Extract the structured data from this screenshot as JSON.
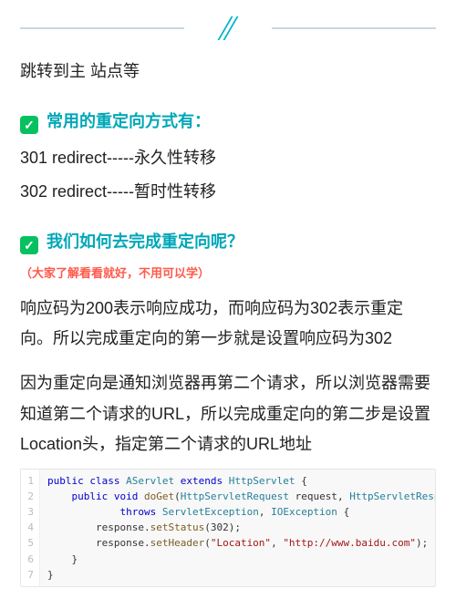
{
  "intro": "跳转到主 站点等",
  "section1": {
    "heading": "常用的重定向方式有：",
    "lines": [
      "301 redirect-----永久性转移",
      "302 redirect-----暂时性转移"
    ]
  },
  "section2": {
    "heading": "我们如何去完成重定向呢？",
    "note": "（大家了解看看就好，不用可以学）",
    "para1": "响应码为200表示响应成功，而响应码为302表示重定向。所以完成重定向的第一步就是设置响应码为302",
    "para2": "因为重定向是通知浏览器再第二个请求，所以浏览器需要知道第二个请求的URL，所以完成重定向的第二步是设置Location头，指定第二个请求的URL地址"
  },
  "code": {
    "l1": "public class AServlet extends HttpServlet {",
    "l2": "    public void doGet(HttpServletRequest request, HttpServletResponse response)",
    "l3": "            throws ServletException, IOException {",
    "l4": "        response.setStatus(302);",
    "l5": "        response.setHeader(\"Location\", \"http://www.baidu.com\");",
    "l6": "    }",
    "l7": "}"
  },
  "colors": {
    "accent": "#00a7b8",
    "green": "#07c160",
    "red": "#ff5a4c"
  }
}
